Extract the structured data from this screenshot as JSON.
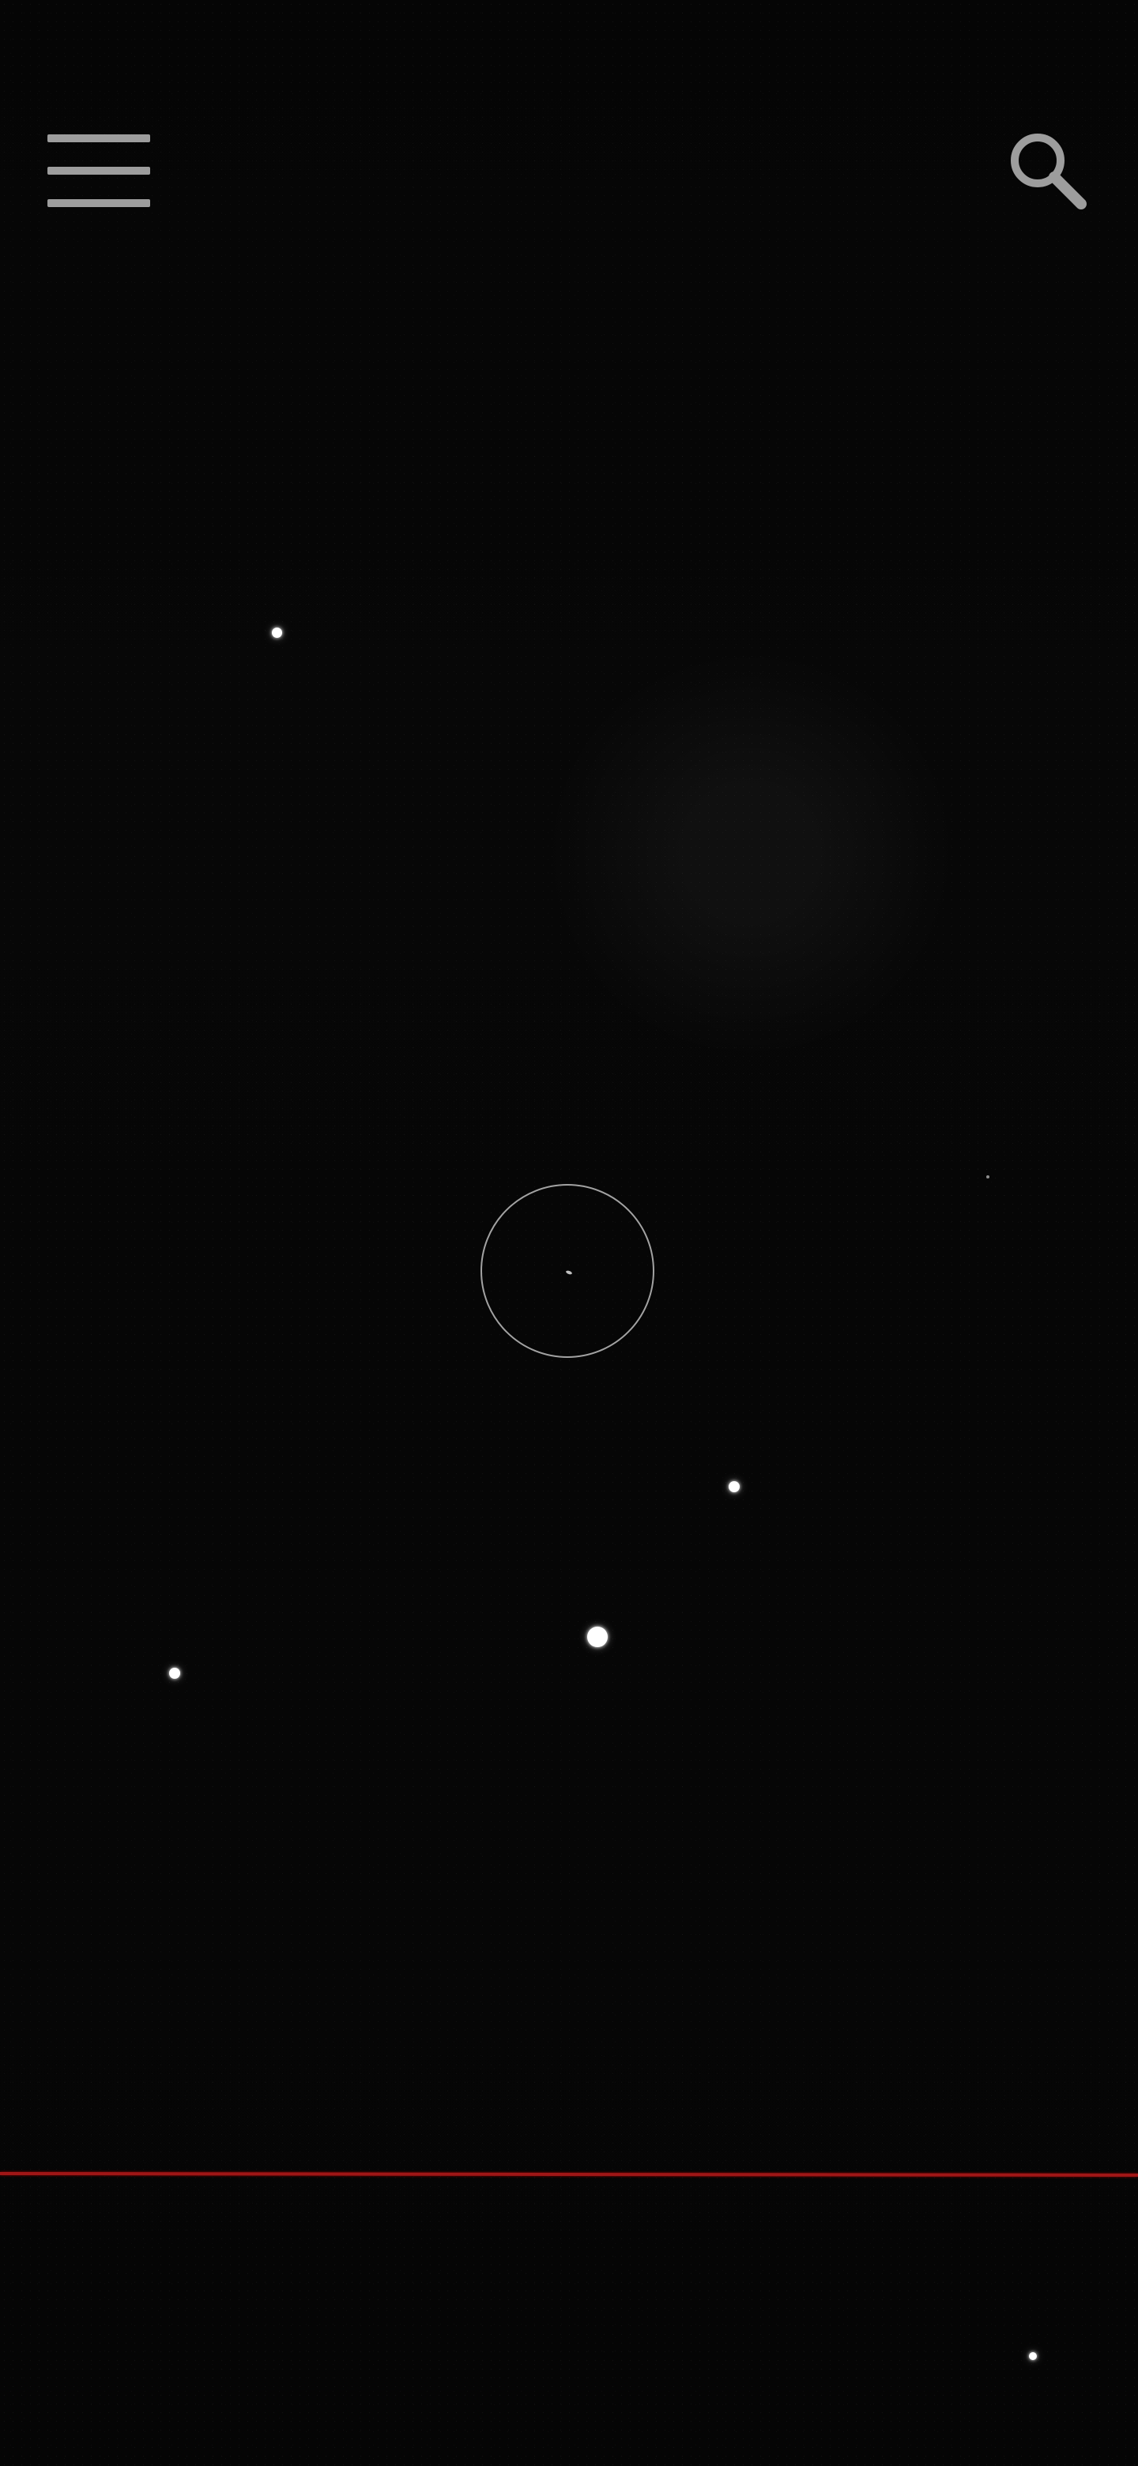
{
  "screen": {
    "background": "#060606"
  },
  "toolbar": {
    "menu_icon": "hamburger-menu-icon",
    "search_icon": "search-icon",
    "icon_color": "#9d9d9d"
  },
  "sky_view": {
    "reticle": {
      "icon": "circle-target-icon",
      "stroke_color": "#d7d7d7"
    },
    "horizon": {
      "color": "#a01616"
    },
    "visible_stars": 5
  }
}
